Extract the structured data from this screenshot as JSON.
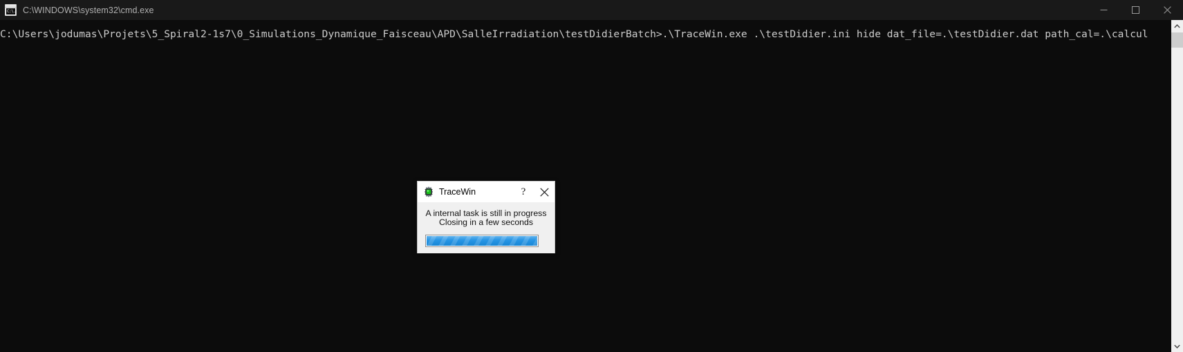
{
  "window": {
    "title": "C:\\WINDOWS\\system32\\cmd.exe",
    "icon": "cmd-console-icon",
    "icon_glyph": "C:\\.",
    "controls": {
      "minimize_label": "Minimize",
      "maximize_label": "Maximize",
      "close_label": "Close"
    },
    "background_color": "#0c0c0c",
    "titlebar_color": "#191919",
    "title_text_color": "#b0b0b0"
  },
  "console": {
    "lines": [
      "C:\\Users\\jodumas\\Projets\\5_Spiral2-1s7\\0_Simulations_Dynamique_Faisceau\\APD\\SalleIrradiation\\testDidierBatch>.\\TraceWin.exe .\\testDidier.ini hide dat_file=.\\testDidier.dat path_cal=.\\calcul"
    ],
    "text_color": "#cccccc"
  },
  "scrollbar": {
    "up_arrow": "scroll-up-arrow",
    "down_arrow": "scroll-down-arrow",
    "track_color": "#f0f0f0",
    "thumb_color": "#cdcdcd"
  },
  "dialog": {
    "title": "TraceWin",
    "icon": "tracewin-gem-icon",
    "accent_color": "#1a8fe3",
    "help_label": "?",
    "close_label": "✕",
    "message": "A internal task is still in progress\nClosing in a few seconds",
    "progress": {
      "type": "indeterminate-marquee",
      "color": "#1a8fe3"
    }
  }
}
